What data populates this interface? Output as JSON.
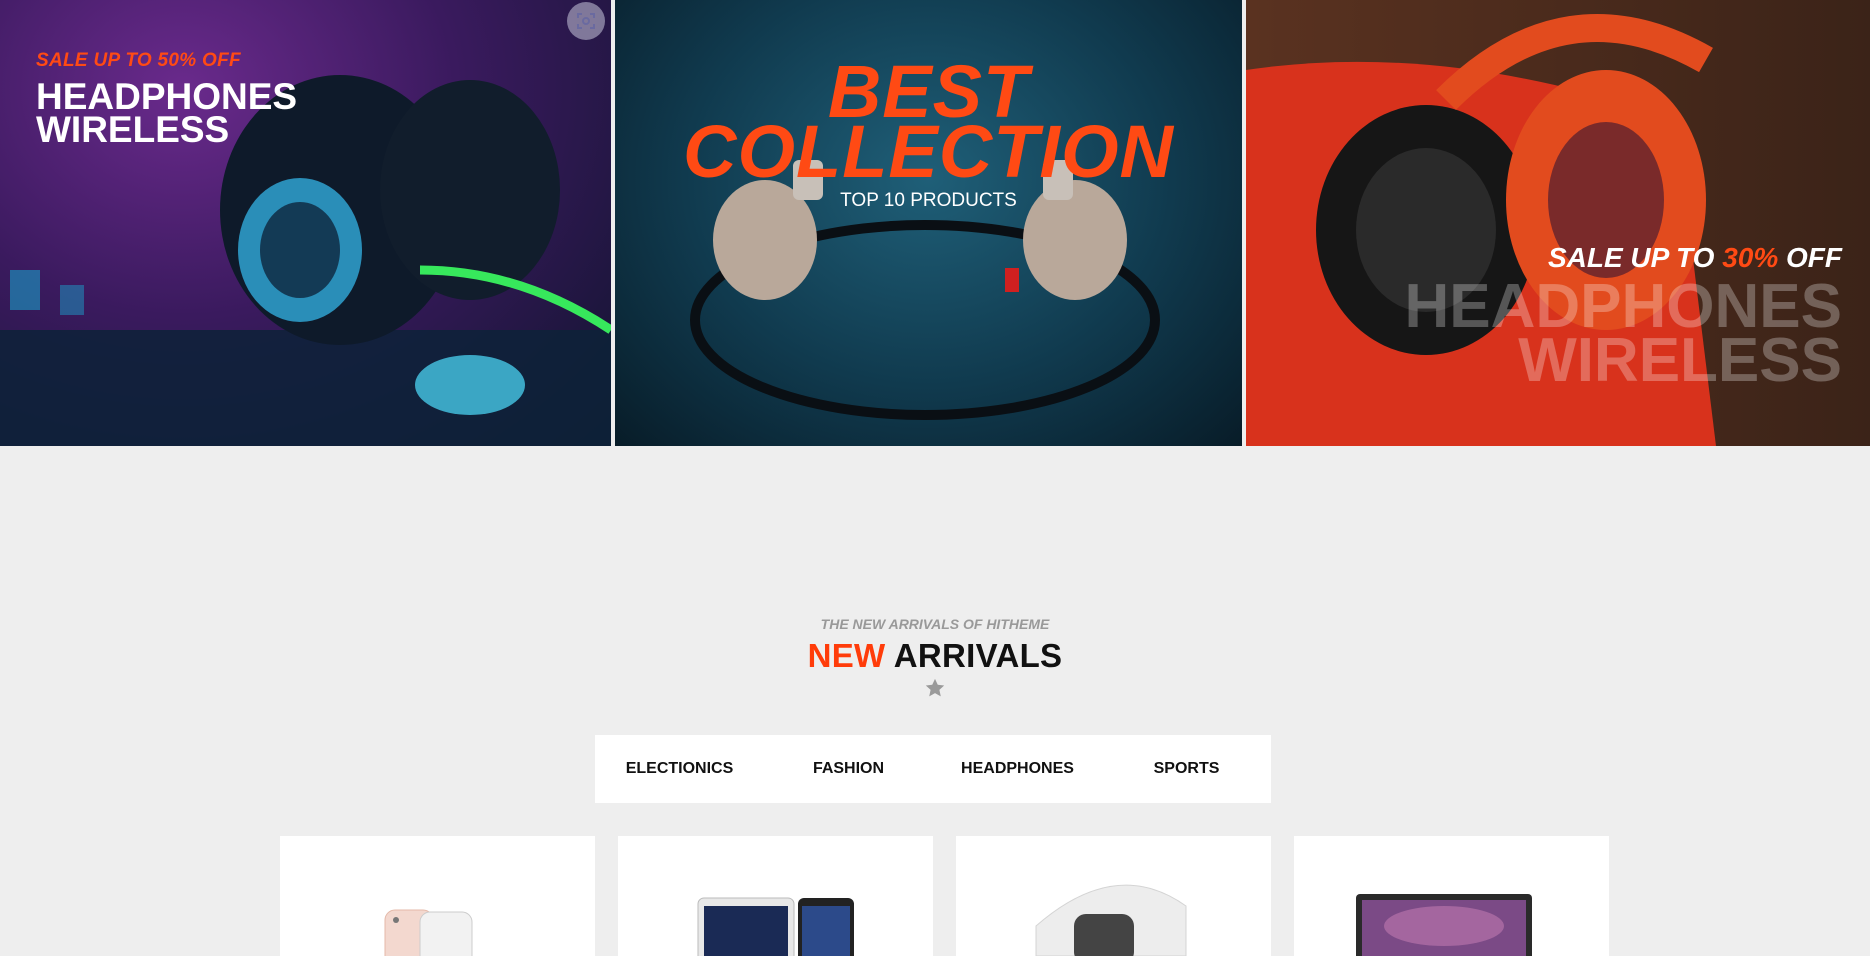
{
  "banners": [
    {
      "kicker": "SALE UP TO 50% OFF",
      "title_line1": "HEADPHONES",
      "title_line2": "WIRELESS"
    },
    {
      "title_line1": "BEST",
      "title_line2": "COLLECTION",
      "subtitle": "TOP 10 PRODUCTS"
    },
    {
      "kicker_pre": "SALE UP TO ",
      "kicker_accent": "30%",
      "kicker_post": " OFF",
      "ghost_line1": "HEADPHONES",
      "ghost_line2": "WIRELESS"
    }
  ],
  "section": {
    "eyebrow": "THE NEW ARRIVALS OF HITHEME",
    "heading_accent": "NEW",
    "heading_rest": " ARRIVALS"
  },
  "tabs": [
    "ELECTIONICS",
    "FASHION",
    "HEADPHONES",
    "SPORTS"
  ],
  "products": [
    {
      "icon": "phone-product-icon"
    },
    {
      "icon": "tablet-product-icon"
    },
    {
      "icon": "watch-product-icon"
    },
    {
      "icon": "laptop-product-icon"
    }
  ],
  "colors": {
    "accent": "#ff3c0a",
    "background": "#eeeeee"
  }
}
